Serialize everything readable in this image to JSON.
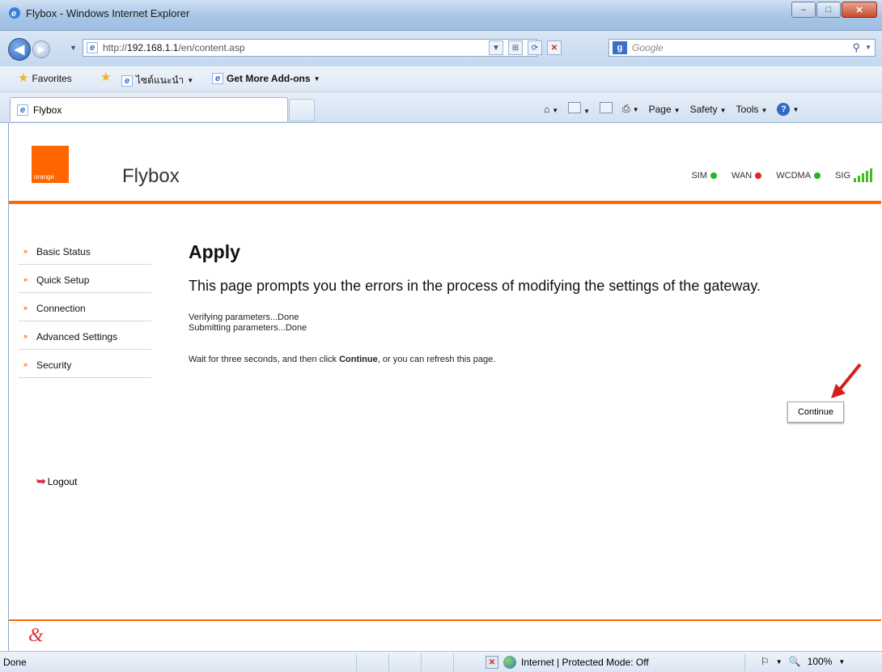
{
  "window": {
    "title": "Flybox - Windows Internet Explorer",
    "controls": {
      "minimize": "–",
      "maximize": "□",
      "close": "✕"
    }
  },
  "address_bar": {
    "url_prefix": "http://",
    "url_host": "192.168.1.1",
    "url_path": "/en/content.asp",
    "search_placeholder": "Google"
  },
  "favorites_bar": {
    "favorites_label": "Favorites",
    "suggested_sites_label": "ไซต์แนะนำ",
    "addons_label": "Get More Add-ons"
  },
  "tab": {
    "label": "Flybox"
  },
  "command_bar": {
    "page_label": "Page",
    "safety_label": "Safety",
    "tools_label": "Tools",
    "help_label": "?"
  },
  "site": {
    "logo_text": "orange",
    "title": "Flybox",
    "status": [
      {
        "label": "SIM",
        "color": "#1fb81f"
      },
      {
        "label": "WAN",
        "color": "#e0262a"
      },
      {
        "label": "WCDMA",
        "color": "#1fb81f"
      }
    ],
    "signal_label": "SIG",
    "signal_bars": 5,
    "brand_color": "#ff6600"
  },
  "sidenav": {
    "items": [
      {
        "label": "Basic Status"
      },
      {
        "label": "Quick Setup"
      },
      {
        "label": "Connection"
      },
      {
        "label": "Advanced Settings"
      },
      {
        "label": "Security"
      }
    ],
    "logout_label": "Logout"
  },
  "main": {
    "heading": "Apply",
    "subheading": "This page prompts you the errors in the process of modifying the settings of the gateway.",
    "messages": [
      "Verifying parameters...Done",
      "Submitting parameters...Done"
    ],
    "wait_before": "Wait for three seconds, and then click ",
    "wait_bold": "Continue",
    "wait_after": ", or you can refresh this page.",
    "continue_label": "Continue"
  },
  "footer": {
    "brand_mark": "&"
  },
  "status_bar": {
    "status_text": "Done",
    "zone_text": "Internet | Protected Mode: Off",
    "zoom_text": "100%"
  }
}
